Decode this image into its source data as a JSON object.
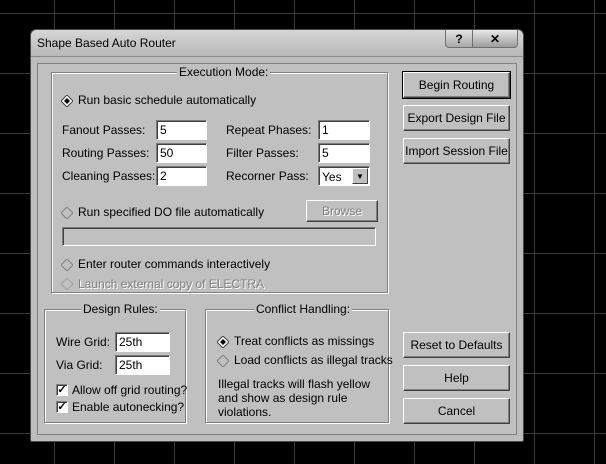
{
  "window": {
    "title": "Shape Based Auto Router",
    "help_glyph": "?",
    "close_glyph": "✕"
  },
  "execution": {
    "title": "Execution Mode:",
    "run_basic": "Run basic schedule automatically",
    "fanout_label": "Fanout Passes:",
    "fanout_value": "5",
    "repeat_label": "Repeat Phases:",
    "repeat_value": "1",
    "routing_label": "Routing Passes:",
    "routing_value": "50",
    "filter_label": "Filter Passes:",
    "filter_value": "5",
    "cleaning_label": "Cleaning Passes:",
    "cleaning_value": "2",
    "recorner_label": "Recorner Pass:",
    "recorner_value": "Yes",
    "run_do": "Run specified DO file automatically",
    "browse": "Browse",
    "do_path": "",
    "enter_cmds": "Enter router commands interactively",
    "launch_external": "Launch external copy of ELECTRA"
  },
  "design_rules": {
    "title": "Design Rules:",
    "wire_grid_label": "Wire Grid:",
    "wire_grid_value": "25th",
    "via_grid_label": "Via Grid:",
    "via_grid_value": "25th",
    "allow_off_grid": "Allow off grid routing?",
    "enable_autonecking": "Enable autonecking?"
  },
  "conflict": {
    "title": "Conflict Handling:",
    "treat_missings": "Treat conflicts as missings",
    "load_illegal": "Load conflicts as illegal tracks",
    "note": "Illegal tracks will flash yellow and show as design rule violations."
  },
  "buttons": {
    "begin_routing": "Begin Routing",
    "export_design": "Export Design File",
    "import_session": "Import Session File",
    "reset_defaults": "Reset to Defaults",
    "help": "Help",
    "cancel": "Cancel"
  }
}
